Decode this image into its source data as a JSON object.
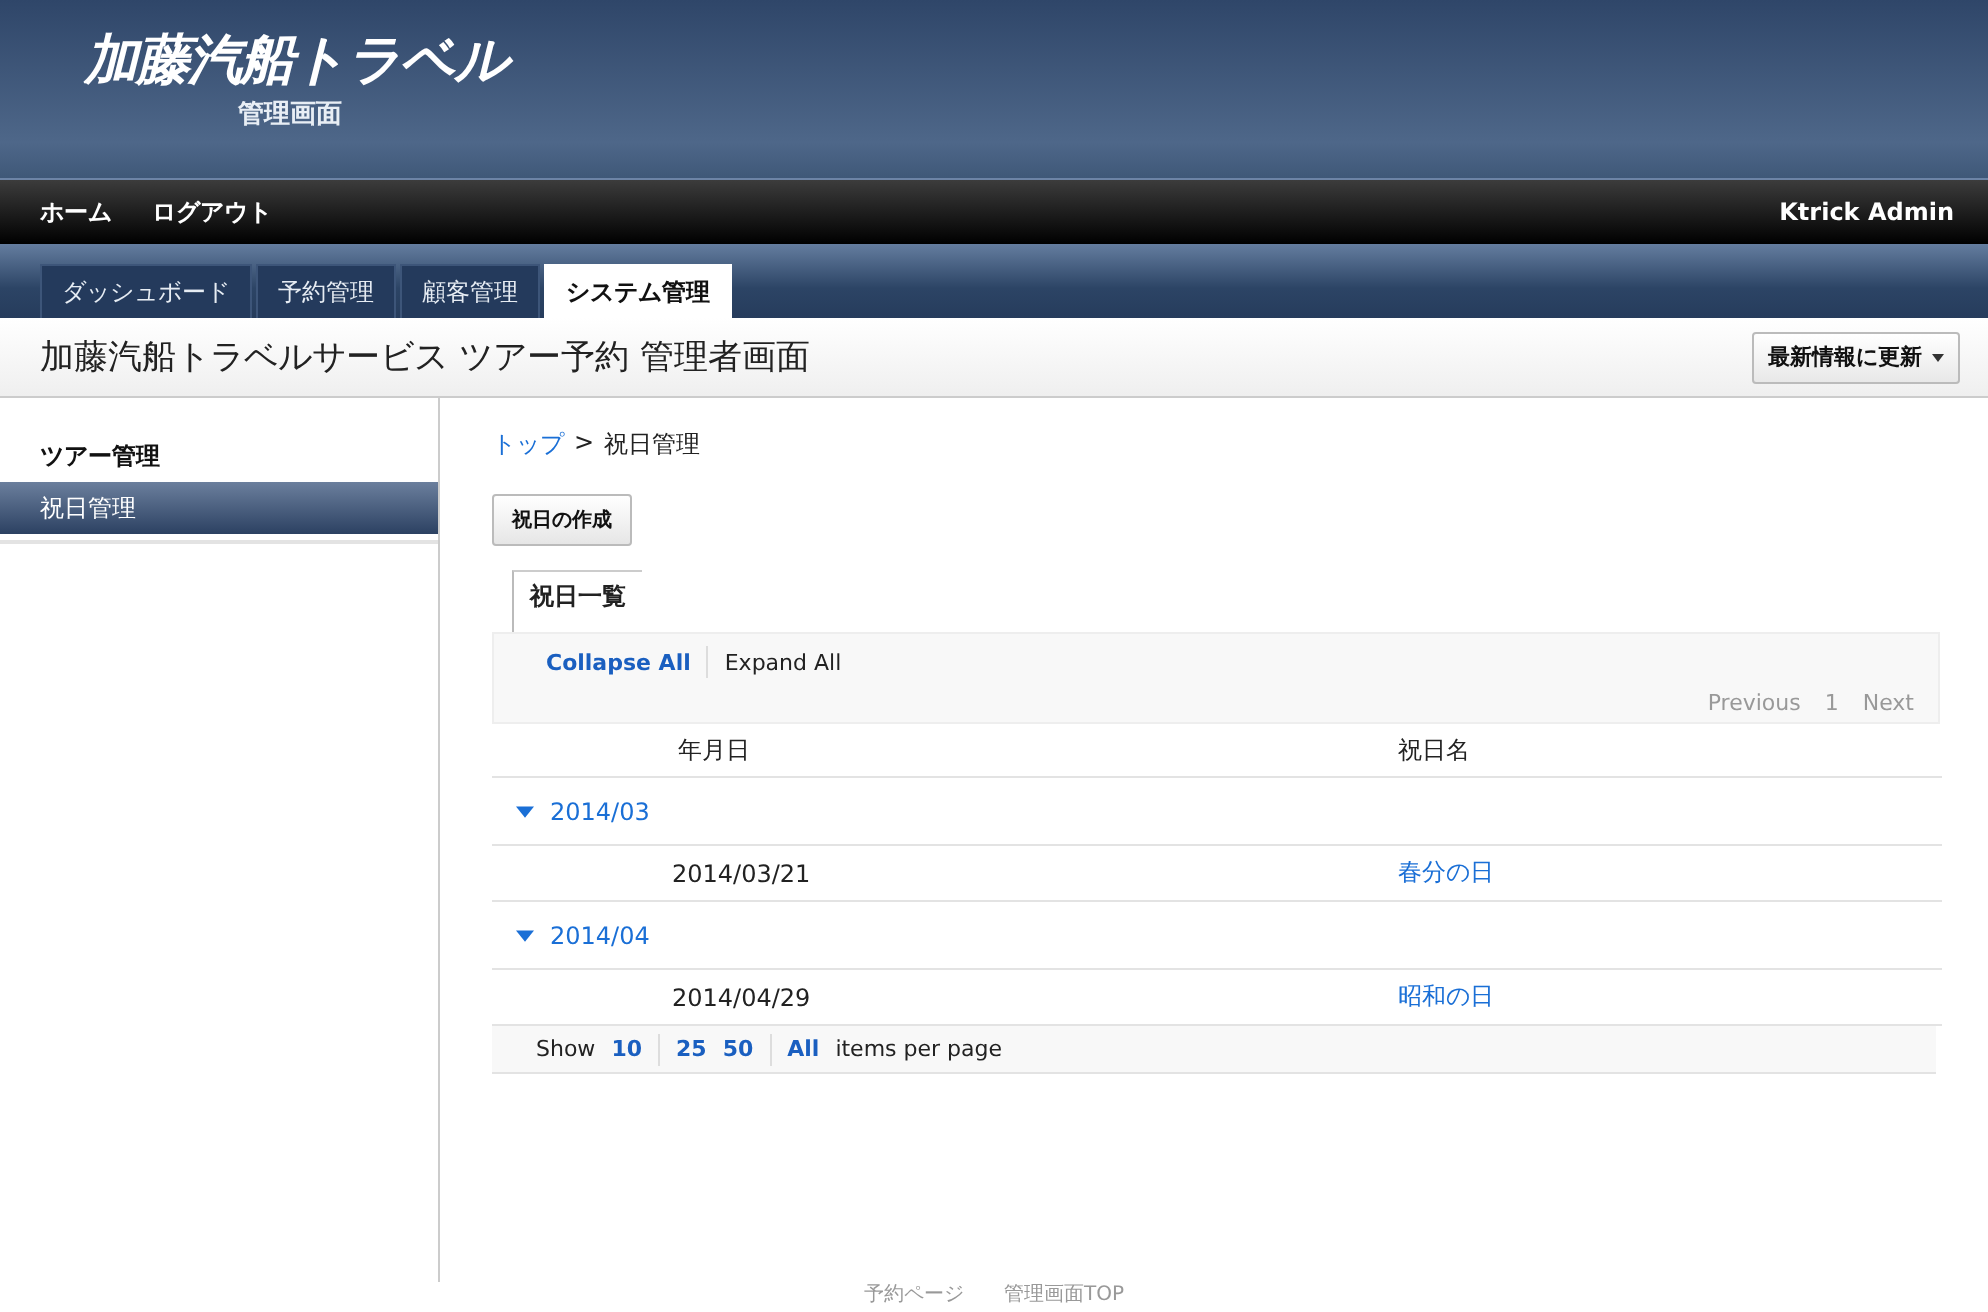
{
  "header": {
    "logo": "加藤汽船トラベル",
    "subtitle": "管理画面"
  },
  "nav": {
    "items": [
      "ホーム",
      "ログアウト"
    ],
    "user": "Ktrick Admin"
  },
  "tabs": [
    {
      "label": "ダッシュボード",
      "selected": false
    },
    {
      "label": "予約管理",
      "selected": false
    },
    {
      "label": "顧客管理",
      "selected": false
    },
    {
      "label": "システム管理",
      "selected": true
    }
  ],
  "page_title": "加藤汽船トラベルサービス ツアー予約 管理者画面",
  "refresh_button": "最新情報に更新",
  "sidebar": {
    "items": [
      {
        "label": "ツアー管理",
        "kind": "heading",
        "selected": false
      },
      {
        "label": "祝日管理",
        "kind": "item",
        "selected": true
      }
    ]
  },
  "breadcrumb": {
    "items": [
      "トップ",
      "祝日管理"
    ],
    "separator": ">"
  },
  "create_button": "祝日の作成",
  "list_tab": "祝日一覧",
  "toolbar": {
    "collapse": "Collapse All",
    "expand": "Expand All",
    "previous": "Previous",
    "page": "1",
    "next": "Next"
  },
  "table": {
    "columns": [
      "年月日",
      "祝日名"
    ],
    "groups": [
      {
        "label": "2014/03",
        "expanded": true,
        "rows": [
          {
            "date": "2014/03/21",
            "name": "春分の日"
          }
        ]
      },
      {
        "label": "2014/04",
        "expanded": true,
        "rows": [
          {
            "date": "2014/04/29",
            "name": "昭和の日"
          }
        ]
      }
    ]
  },
  "page_size": {
    "show": "Show",
    "options": [
      "10",
      "25",
      "50",
      "All"
    ],
    "suffix": "items per page"
  },
  "footer": [
    "予約ページ",
    "管理画面TOP"
  ]
}
